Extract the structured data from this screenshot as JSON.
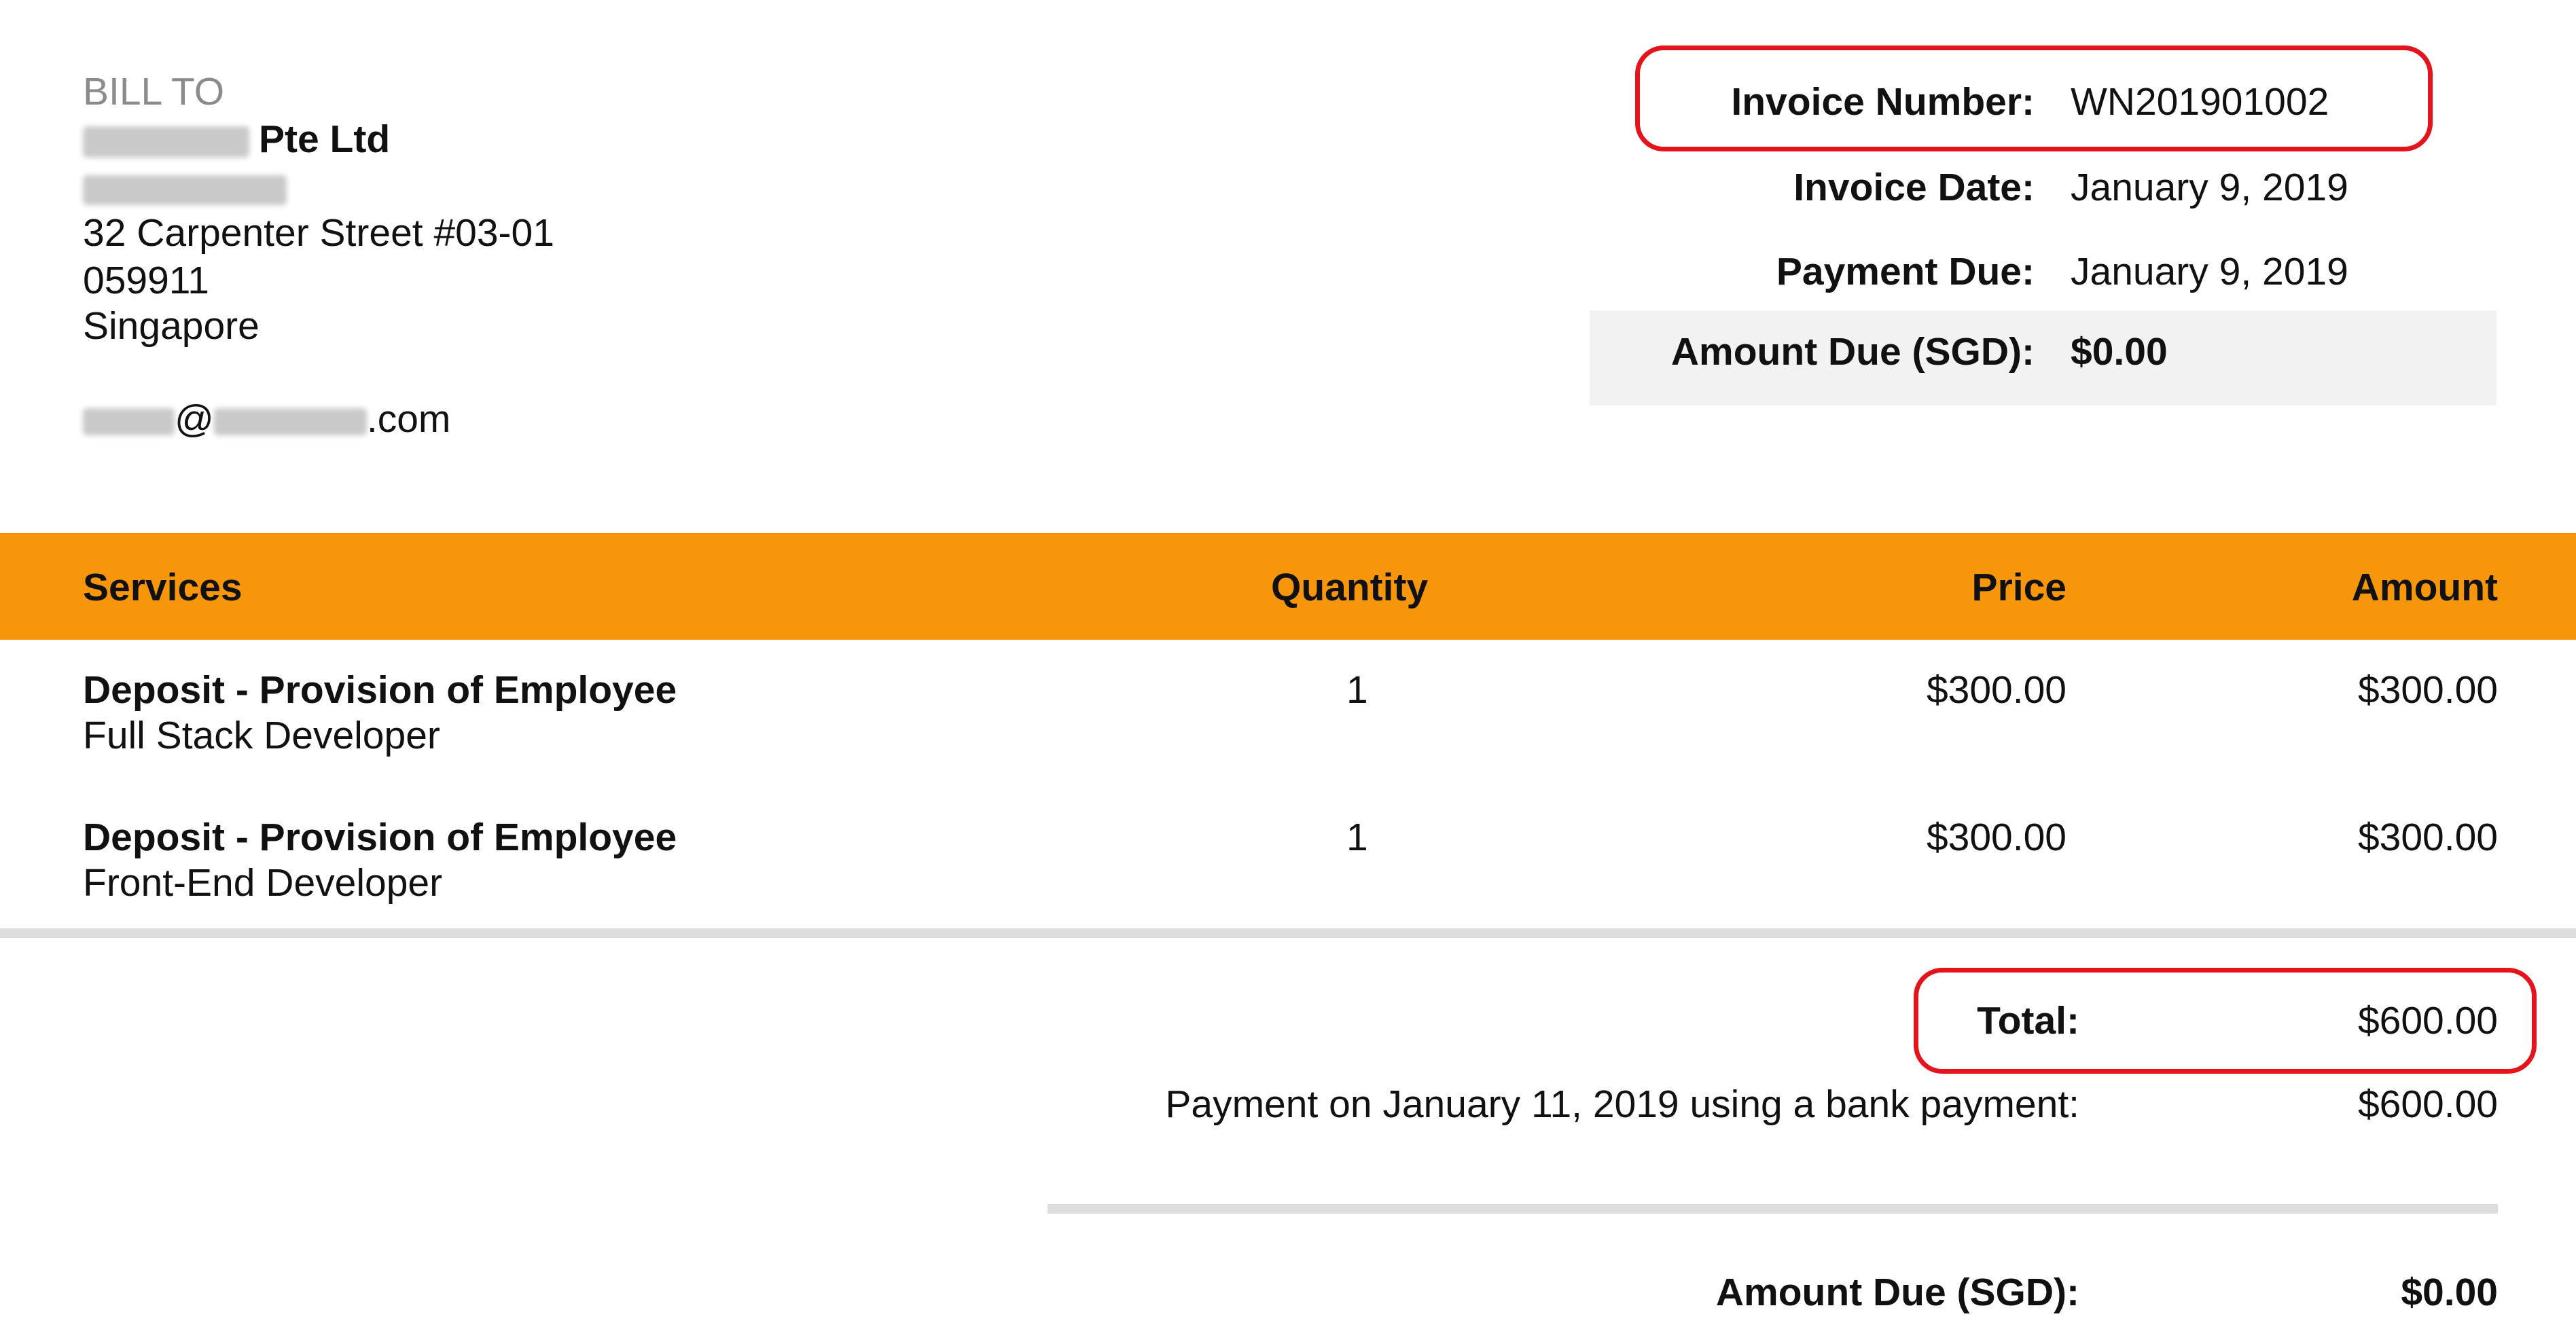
{
  "bill_to": {
    "label": "BILL TO",
    "company_suffix": "Pte Ltd",
    "address_line1": "32 Carpenter Street #03-01",
    "postal_code": "059911",
    "country": "Singapore",
    "email_at": "@",
    "email_domain_suffix": ".com"
  },
  "invoice_meta": {
    "number_label": "Invoice Number:",
    "number_value": "WN201901002",
    "date_label": "Invoice Date:",
    "date_value": "January 9, 2019",
    "due_label": "Payment Due:",
    "due_value": "January 9, 2019",
    "amount_due_label": "Amount Due (SGD):",
    "amount_due_value": "$0.00"
  },
  "table": {
    "headers": {
      "services": "Services",
      "quantity": "Quantity",
      "price": "Price",
      "amount": "Amount"
    },
    "rows": [
      {
        "service": "Deposit - Provision of Employee",
        "description": "Full Stack Developer",
        "quantity": "1",
        "price": "$300.00",
        "amount": "$300.00"
      },
      {
        "service": "Deposit - Provision of Employee",
        "description": "Front-End Developer",
        "quantity": "1",
        "price": "$300.00",
        "amount": "$300.00"
      }
    ]
  },
  "totals": {
    "total_label": "Total:",
    "total_value": "$600.00",
    "payment_label": "Payment on January 11, 2019 using a bank payment:",
    "payment_value": "$600.00",
    "amount_due_label": "Amount Due (SGD):",
    "amount_due_value": "$0.00"
  },
  "colors": {
    "header_bar": "#f7960a",
    "highlight_outline": "#e3141c",
    "muted_label": "#8b8b8b"
  }
}
